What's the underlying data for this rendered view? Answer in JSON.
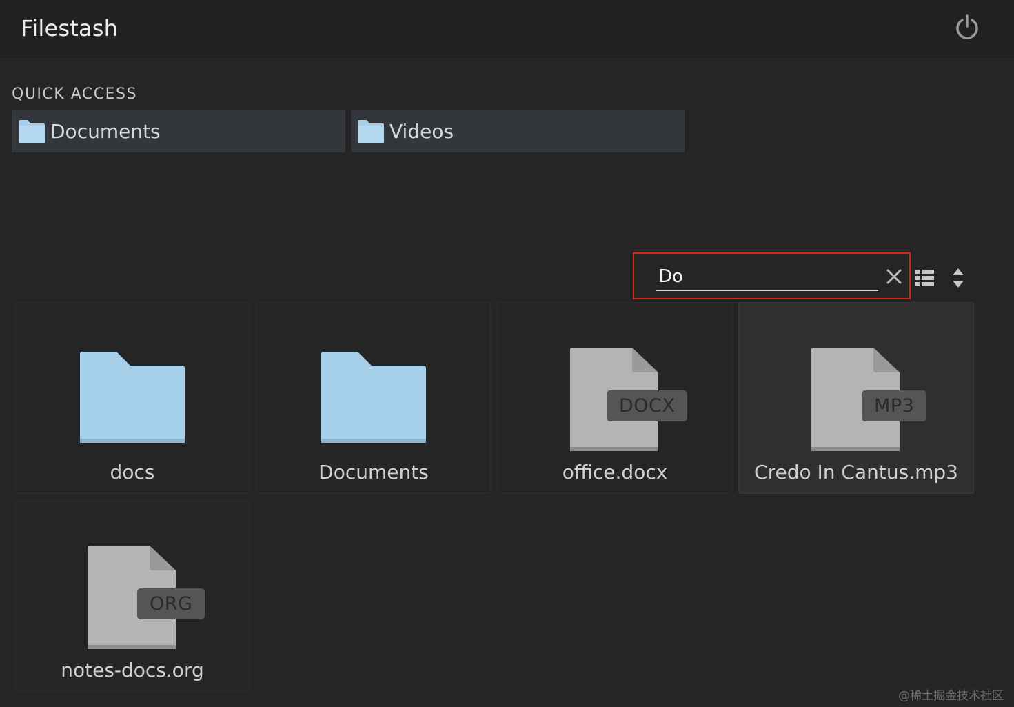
{
  "app": {
    "title": "Filestash",
    "power_icon": "power-icon"
  },
  "quick_access": {
    "heading": "QUICK ACCESS",
    "items": [
      {
        "label": "Documents",
        "icon": "folder-icon"
      },
      {
        "label": "Videos",
        "icon": "folder-icon"
      }
    ]
  },
  "toolbar": {
    "search_value": "Do",
    "clear_icon": "close-icon",
    "view_icon": "list-view-icon",
    "sort_icon": "sort-icon"
  },
  "files": [
    {
      "name": "docs",
      "type": "folder"
    },
    {
      "name": "Documents",
      "type": "folder"
    },
    {
      "name": "office.docx",
      "type": "file",
      "badge": "DOCX"
    },
    {
      "name": "Credo In Cantus.mp3",
      "type": "file",
      "badge": "MP3",
      "selected": true
    },
    {
      "name": "notes-docs.org",
      "type": "file",
      "badge": "ORG"
    }
  ],
  "watermark": "@稀土掘金技术社区",
  "colors": {
    "background": "#252525",
    "folder": "#a6cfea",
    "file": "#b4b4b4",
    "highlight_border": "#d9261c"
  }
}
